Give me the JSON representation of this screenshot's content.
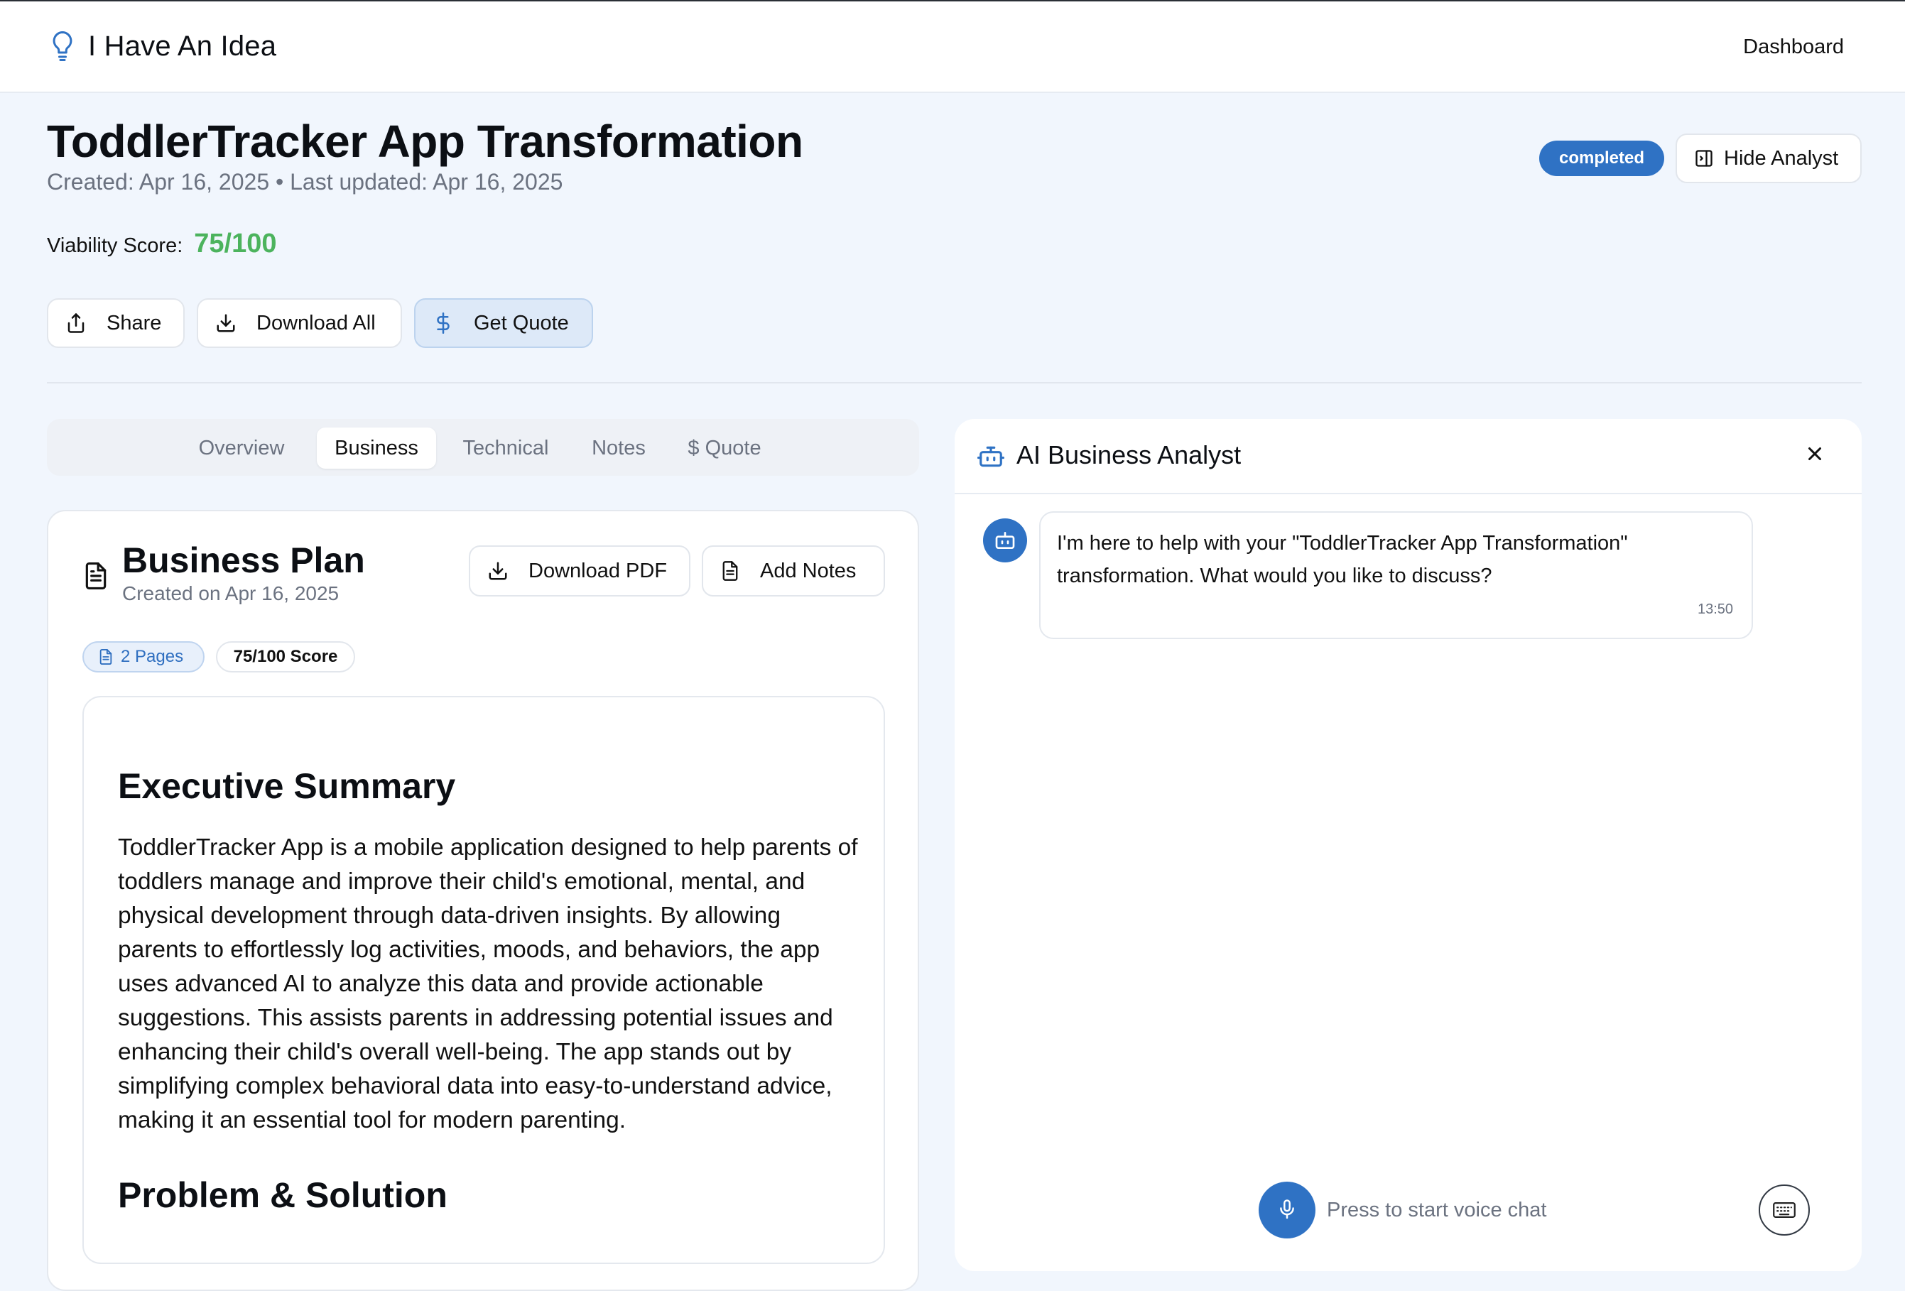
{
  "header": {
    "app_name": "I Have An Idea",
    "nav_dashboard": "Dashboard"
  },
  "project": {
    "title": "ToddlerTracker App Transformation",
    "meta": "Created: Apr 16, 2025 • Last updated: Apr 16, 2025",
    "viability_label": "Viability Score:",
    "viability_value": "75/100",
    "status": "completed",
    "hide_analyst_label": "Hide Analyst"
  },
  "actions": {
    "share": "Share",
    "download_all": "Download All",
    "get_quote": "Get Quote"
  },
  "tabs": [
    {
      "label": "Overview",
      "active": false
    },
    {
      "label": "Business",
      "active": true
    },
    {
      "label": "Technical",
      "active": false
    },
    {
      "label": "Notes",
      "active": false
    },
    {
      "label": "$ Quote",
      "active": false
    }
  ],
  "document": {
    "title": "Business Plan",
    "subtitle": "Created on Apr 16, 2025",
    "download_pdf": "Download PDF",
    "add_notes": "Add Notes",
    "pages_badge": "2 Pages",
    "score_badge": "75/100 Score",
    "section1_heading": "Executive Summary",
    "section1_text": "ToddlerTracker App is a mobile application designed to help parents of toddlers manage and improve their child's emotional, mental, and physical development through data-driven insights. By allowing parents to effortlessly log activities, moods, and behaviors, the app uses advanced AI to analyze this data and provide actionable suggestions. This assists parents in addressing potential issues and enhancing their child's overall well-being. The app stands out by simplifying complex behavioral data into easy-to-understand advice, making it an essential tool for modern parenting.",
    "section2_heading": "Problem & Solution"
  },
  "chat": {
    "title": "AI Business Analyst",
    "message_text": "I'm here to help with your \"ToddlerTracker App Transformation\" transformation. What would you like to discuss?",
    "message_time": "13:50",
    "voice_hint": "Press to start voice chat"
  },
  "colors": {
    "accent": "#2f72c4",
    "score_green": "#4cb35d",
    "background": "#f1f6fd"
  },
  "icons": {
    "logo": "lightbulb-icon",
    "share": "share-icon",
    "download": "download-icon",
    "dollar": "dollar-icon",
    "sidebar_toggle": "panel-icon",
    "document": "file-text-icon",
    "bot": "bot-icon",
    "close": "close-icon",
    "mic": "mic-icon",
    "keyboard": "keyboard-icon"
  }
}
